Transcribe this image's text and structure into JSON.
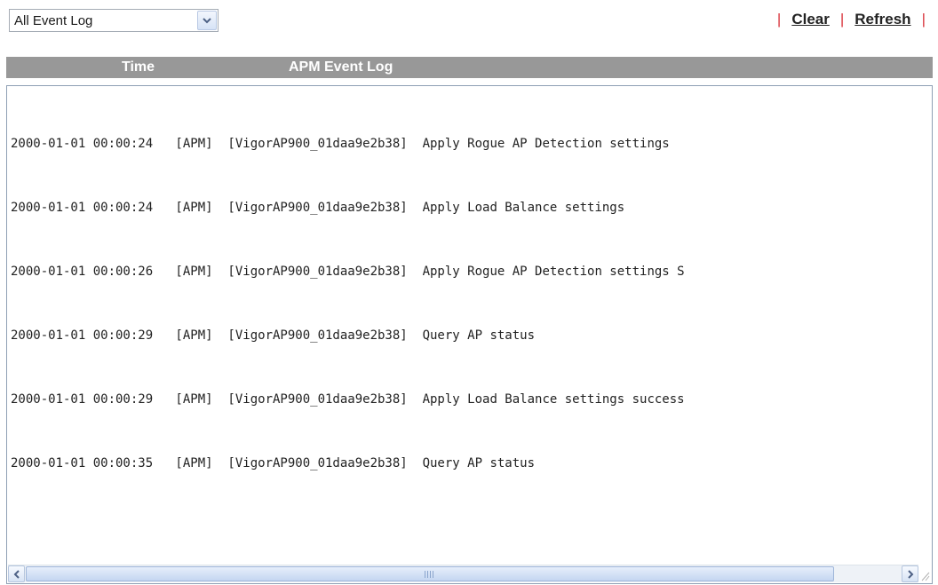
{
  "filter": {
    "selected": "All Event Log",
    "arrow_icon": "chevron-down-icon"
  },
  "actions": {
    "separator": "|",
    "clear_label": "Clear",
    "refresh_label": "Refresh"
  },
  "table": {
    "columns": [
      "Time",
      "APM Event Log"
    ]
  },
  "log": {
    "lines": [
      "2000-01-01 00:00:24   [APM]  [VigorAP900_01daa9e2b38]  Apply Rogue AP Detection settings",
      "2000-01-01 00:00:24   [APM]  [VigorAP900_01daa9e2b38]  Apply Load Balance settings",
      "2000-01-01 00:00:26   [APM]  [VigorAP900_01daa9e2b38]  Apply Rogue AP Detection settings S",
      "2000-01-01 00:00:29   [APM]  [VigorAP900_01daa9e2b38]  Query AP status",
      "2000-01-01 00:00:29   [APM]  [VigorAP900_01daa9e2b38]  Apply Load Balance settings success",
      "2000-01-01 00:00:35   [APM]  [VigorAP900_01daa9e2b38]  Query AP status"
    ]
  },
  "colors": {
    "header_bg": "#989898",
    "separator": "#d9363e"
  }
}
